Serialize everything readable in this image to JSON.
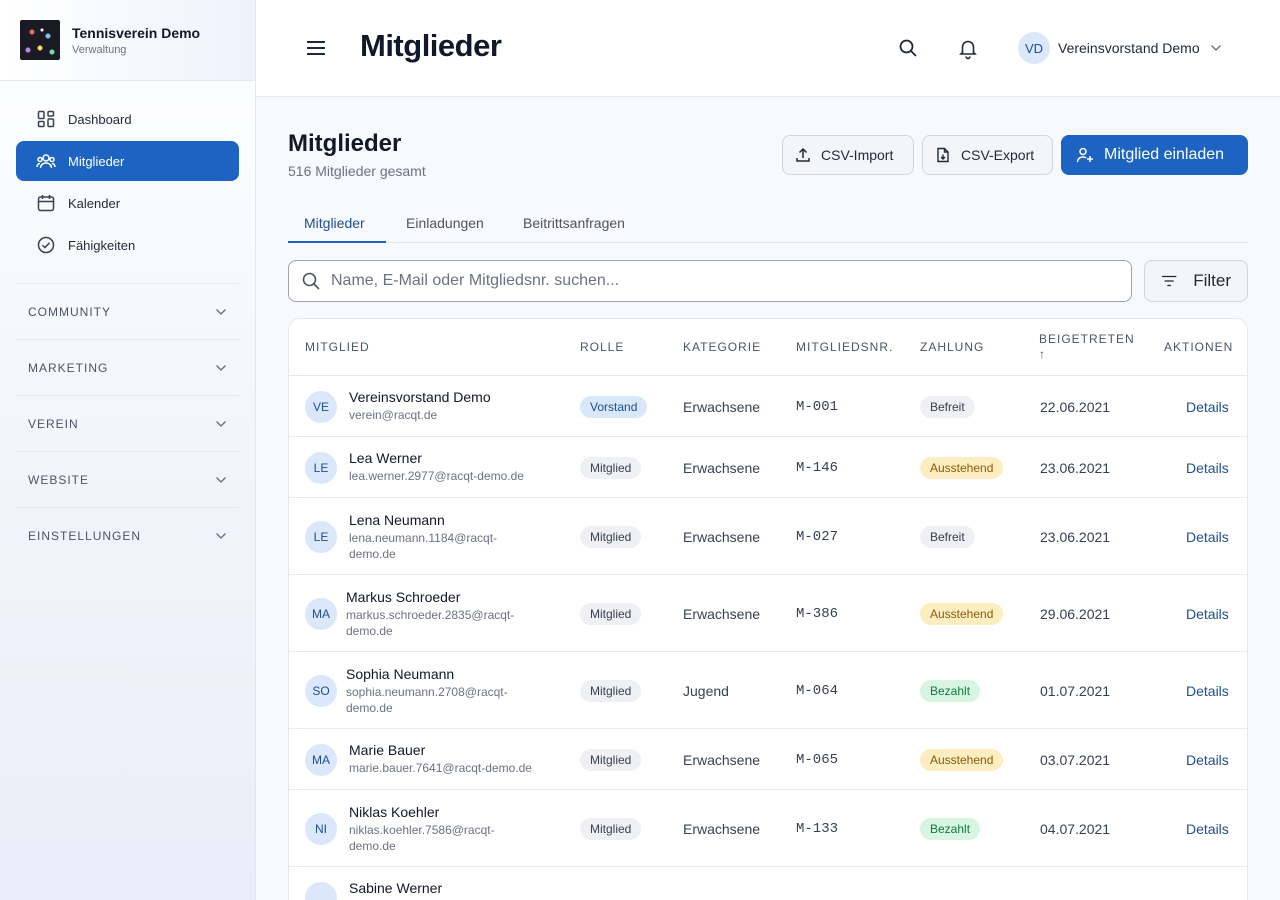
{
  "brand": {
    "title": "Tennisverein Demo",
    "subtitle": "Verwaltung"
  },
  "nav": [
    {
      "label": "Dashboard",
      "icon": "dashboard-icon",
      "active": false
    },
    {
      "label": "Mitglieder",
      "icon": "users-icon",
      "active": true
    },
    {
      "label": "Kalender",
      "icon": "calendar-icon",
      "active": false
    },
    {
      "label": "Fähigkeiten",
      "icon": "check-circle-icon",
      "active": false
    }
  ],
  "sections": [
    "COMMUNITY",
    "MARKETING",
    "VEREIN",
    "WEBSITE",
    "EINSTELLUNGEN"
  ],
  "header": {
    "title": "Mitglieder",
    "user_initials": "VD",
    "user_name": "Vereinsvorstand Demo"
  },
  "main": {
    "title": "Mitglieder",
    "count": "516 Mitglieder gesamt",
    "import_label": "CSV-Import",
    "export_label": "CSV-Export",
    "invite_label": "Mitglied einladen",
    "filter_label": "Filter",
    "search_placeholder": "Name, E-Mail oder Mitgliedsnr. suchen...",
    "search_value": ""
  },
  "tabs": [
    {
      "label": "Mitglieder",
      "active": true
    },
    {
      "label": "Einladungen",
      "active": false
    },
    {
      "label": "Beitrittsanfragen",
      "active": false
    }
  ],
  "table": {
    "columns": [
      "MITGLIED",
      "ROLLE",
      "KATEGORIE",
      "MITGLIEDSNR.",
      "ZAHLUNG",
      "BEIGETRETEN",
      "↑",
      "AKTIONEN"
    ],
    "action_label": "Details",
    "rows": [
      {
        "initials": "VE",
        "name": "Vereinsvorstand Demo",
        "email": [
          "verein@racqt.de"
        ],
        "role": "Vorstand",
        "category": "Erwachsene",
        "number": "M-001",
        "payment": "Befreit",
        "joined": "22.06.2021"
      },
      {
        "initials": "LE",
        "name": "Lea Werner",
        "email": [
          "lea.werner.2977@racqt-demo.de"
        ],
        "role": "Mitglied",
        "category": "Erwachsene",
        "number": "M-146",
        "payment": "Ausstehend",
        "joined": "23.06.2021"
      },
      {
        "initials": "LE",
        "name": "Lena Neumann",
        "email": [
          "lena.neumann.1184@racqt-",
          "demo.de"
        ],
        "role": "Mitglied",
        "category": "Erwachsene",
        "number": "M-027",
        "payment": "Befreit",
        "joined": "23.06.2021"
      },
      {
        "initials": "MA",
        "name": "Markus Schroeder",
        "email": [
          "markus.schroeder.2835@racqt-",
          "demo.de"
        ],
        "role": "Mitglied",
        "category": "Erwachsene",
        "number": "M-386",
        "payment": "Ausstehend",
        "joined": "29.06.2021"
      },
      {
        "initials": "SO",
        "name": "Sophia Neumann",
        "email": [
          "sophia.neumann.2708@racqt-",
          "demo.de"
        ],
        "role": "Mitglied",
        "category": "Jugend",
        "number": "M-064",
        "payment": "Bezahlt",
        "joined": "01.07.2021"
      },
      {
        "initials": "MA",
        "name": "Marie Bauer",
        "email": [
          "marie.bauer.7641@racqt-demo.de"
        ],
        "role": "Mitglied",
        "category": "Erwachsene",
        "number": "M-065",
        "payment": "Ausstehend",
        "joined": "03.07.2021"
      },
      {
        "initials": "NI",
        "name": "Niklas Koehler",
        "email": [
          "niklas.koehler.7586@racqt-",
          "demo.de"
        ],
        "role": "Mitglied",
        "category": "Erwachsene",
        "number": "M-133",
        "payment": "Bezahlt",
        "joined": "04.07.2021"
      },
      {
        "initials": "",
        "name": "Sabine Werner",
        "email": [
          ""
        ],
        "role": "",
        "category": "",
        "number": "",
        "payment": "",
        "joined": ""
      }
    ]
  },
  "colors": {
    "accent": "#1d63c1",
    "pending": "#fdeec2",
    "paid": "#d8f5e2",
    "neutral": "#eef0f3"
  }
}
